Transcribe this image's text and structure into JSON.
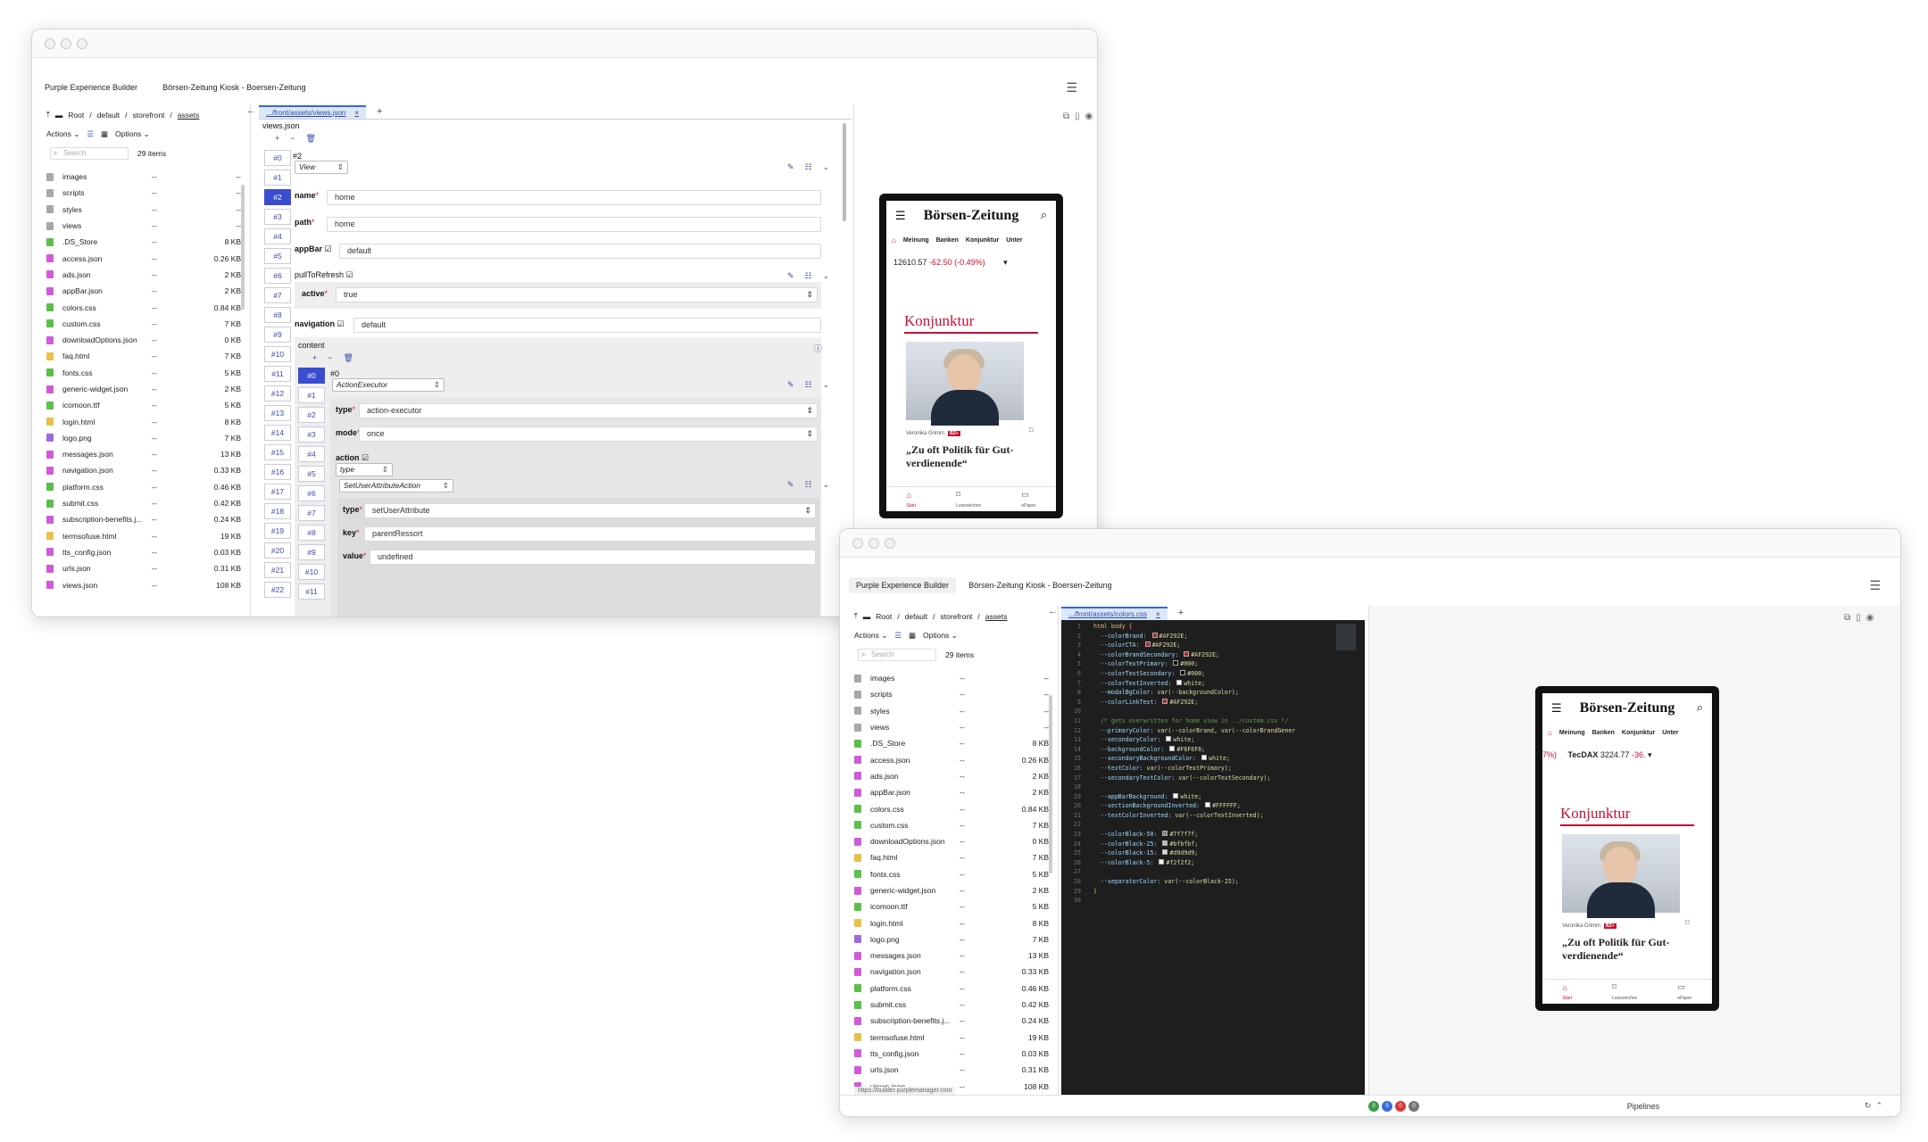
{
  "app": {
    "tab_builder": "Purple Experience Builder",
    "tab_kiosk": "Börsen-Zeitung Kiosk - Boersen-Zeitung",
    "menu_icon": "hamburger-icon"
  },
  "browser": {
    "breadcrumb": [
      "Root",
      "default",
      "storefront",
      "assets"
    ],
    "actions_label": "Actions",
    "options_label": "Options",
    "search_placeholder": "Search",
    "count": "29 items",
    "files": [
      {
        "name": "images",
        "date": "--",
        "size": "--",
        "color": "#a8a8a8"
      },
      {
        "name": "scripts",
        "date": "--",
        "size": "--",
        "color": "#a8a8a8"
      },
      {
        "name": "styles",
        "date": "--",
        "size": "--",
        "color": "#a8a8a8"
      },
      {
        "name": "views",
        "date": "--",
        "size": "--",
        "color": "#a8a8a8"
      },
      {
        "name": ".DS_Store",
        "date": "--",
        "size": "8 KB",
        "color": "#5bbf4a"
      },
      {
        "name": "access.json",
        "date": "--",
        "size": "0.26 KB",
        "color": "#d15ad9"
      },
      {
        "name": "ads.json",
        "date": "--",
        "size": "2 KB",
        "color": "#d15ad9"
      },
      {
        "name": "appBar.json",
        "date": "--",
        "size": "2 KB",
        "color": "#d15ad9"
      },
      {
        "name": "colors.css",
        "date": "--",
        "size": "0.84 KB",
        "color": "#5bbf4a"
      },
      {
        "name": "custom.css",
        "date": "--",
        "size": "7 KB",
        "color": "#5bbf4a"
      },
      {
        "name": "downloadOptions.json",
        "date": "--",
        "size": "0 KB",
        "color": "#d15ad9"
      },
      {
        "name": "faq.html",
        "date": "--",
        "size": "7 KB",
        "color": "#e8c14a"
      },
      {
        "name": "fonts.css",
        "date": "--",
        "size": "5 KB",
        "color": "#5bbf4a"
      },
      {
        "name": "generic-widget.json",
        "date": "--",
        "size": "2 KB",
        "color": "#d15ad9"
      },
      {
        "name": "icomoon.ttf",
        "date": "--",
        "size": "5 KB",
        "color": "#5bbf4a"
      },
      {
        "name": "login.html",
        "date": "--",
        "size": "8 KB",
        "color": "#e8c14a"
      },
      {
        "name": "logo.png",
        "date": "--",
        "size": "7 KB",
        "color": "#a06ae0"
      },
      {
        "name": "messages.json",
        "date": "--",
        "size": "13 KB",
        "color": "#d15ad9"
      },
      {
        "name": "navigation.json",
        "date": "--",
        "size": "0.33 KB",
        "color": "#d15ad9"
      },
      {
        "name": "platform.css",
        "date": "--",
        "size": "0.46 KB",
        "color": "#5bbf4a"
      },
      {
        "name": "submit.css",
        "date": "--",
        "size": "0.42 KB",
        "color": "#5bbf4a"
      },
      {
        "name": "subscription-benefits.j...",
        "date": "--",
        "size": "0.24 KB",
        "color": "#d15ad9"
      },
      {
        "name": "termsofuse.html",
        "date": "--",
        "size": "19 KB",
        "color": "#e8c14a"
      },
      {
        "name": "tts_config.json",
        "date": "--",
        "size": "0.03 KB",
        "color": "#d15ad9"
      },
      {
        "name": "urls.json",
        "date": "--",
        "size": "0.31 KB",
        "color": "#d15ad9"
      },
      {
        "name": "views.json",
        "date": "--",
        "size": "108 KB",
        "color": "#d15ad9"
      }
    ],
    "status_url": "https://builder.purplemanager.com"
  },
  "editorA": {
    "tab": ".../front/assets/views.json",
    "file_title": "views.json",
    "index_outer": [
      "#0",
      "#1",
      "#2",
      "#3",
      "#4",
      "#5",
      "#6",
      "#7",
      "#8",
      "#9",
      "#10",
      "#11",
      "#12",
      "#13",
      "#14",
      "#15",
      "#16",
      "#17",
      "#18",
      "#19",
      "#20",
      "#21",
      "#22"
    ],
    "index_inner": [
      "#0",
      "#1",
      "#2",
      "#3",
      "#4",
      "#5",
      "#6",
      "#7",
      "#8",
      "#9",
      "#10",
      "#11"
    ],
    "item_label": "#2",
    "item_type": "View",
    "name_label": "name",
    "name_value": "home",
    "path_label": "path",
    "path_value": "home",
    "appbar_label": "appBar",
    "appbar_value": "default",
    "pull_label": "pullToRefresh",
    "active_label": "active",
    "active_value": "true",
    "nav_label": "navigation",
    "nav_value": "default",
    "content_label": "content",
    "content_item": "#0",
    "content_type": "ActionExecutor",
    "type_label": "type",
    "type_value": "action-executor",
    "mode_label": "mode",
    "mode_value": "once",
    "action_label": "action",
    "action_type_select": "type",
    "action_class": "SetUserAttributeAction",
    "atype_label": "type",
    "atype_value": "setUserAttribute",
    "key_label": "key",
    "key_value": "parentRessort",
    "value_label": "value",
    "value_value": "undefined"
  },
  "editorB": {
    "tab": ".../front/assets/colors.css",
    "lines": [
      {
        "n": "1",
        "t": "html body {",
        "k": "sel"
      },
      {
        "n": "2",
        "t": "  --colorBrand: ",
        "v": "#AF292E;",
        "sw": "#AF292E"
      },
      {
        "n": "3",
        "t": "  --colorCTA: ",
        "v": "#AF292E;",
        "sw": "#AF292E"
      },
      {
        "n": "4",
        "t": "  --colorBrandSecondary: ",
        "v": "#AF292E;",
        "sw": "#AF292E"
      },
      {
        "n": "5",
        "t": "  --colorTextPrimary: ",
        "v": "#000;",
        "sw": "#000000"
      },
      {
        "n": "6",
        "t": "  --colorTextSecondary: ",
        "v": "#000;",
        "sw": "#000000"
      },
      {
        "n": "7",
        "t": "  --colorTextInverted: ",
        "v": "white;",
        "sw": "#ffffff"
      },
      {
        "n": "8",
        "t": "  --modalBgColor: ",
        "v": "var(--backgroundColor);"
      },
      {
        "n": "9",
        "t": "  --colorLinkText: ",
        "v": "#AF292E;",
        "sw": "#AF292E"
      },
      {
        "n": "10",
        "t": ""
      },
      {
        "n": "11",
        "t": "  /* gets overwritten for home view in ../custom.css */",
        "k": "cm"
      },
      {
        "n": "12",
        "t": "  --primaryColor: ",
        "v": "var(--colorBrand, var(--colorBrandGener"
      },
      {
        "n": "13",
        "t": "  --secondaryColor: ",
        "v": "white;",
        "sw": "#ffffff"
      },
      {
        "n": "14",
        "t": "  --backgroundColor: ",
        "v": "#F6F6F6;",
        "sw": "#F6F6F6"
      },
      {
        "n": "15",
        "t": "  --secondaryBackgroundColor: ",
        "v": "white;",
        "sw": "#ffffff"
      },
      {
        "n": "16",
        "t": "  --textColor: ",
        "v": "var(--colorTextPrimary);"
      },
      {
        "n": "17",
        "t": "  --secondaryTextColor: ",
        "v": "var(--colorTextSecondary);"
      },
      {
        "n": "18",
        "t": ""
      },
      {
        "n": "19",
        "t": "  --appBarBackground: ",
        "v": "white;",
        "sw": "#ffffff"
      },
      {
        "n": "20",
        "t": "  --sectionBackgroundInverted: ",
        "v": "#FFFFFF;",
        "sw": "#FFFFFF"
      },
      {
        "n": "21",
        "t": "  --textColorInverted: ",
        "v": "var(--colorTextInverted);"
      },
      {
        "n": "22",
        "t": ""
      },
      {
        "n": "23",
        "t": "  --colorBlack-50: ",
        "v": "#7f7f7f;",
        "sw": "#7f7f7f"
      },
      {
        "n": "24",
        "t": "  --colorBlack-25: ",
        "v": "#bfbfbf;",
        "sw": "#bfbfbf"
      },
      {
        "n": "25",
        "t": "  --colorBlack-15: ",
        "v": "#d9d9d9;",
        "sw": "#d9d9d9"
      },
      {
        "n": "26",
        "t": "  --colorBlack-5: ",
        "v": "#f2f2f2;",
        "sw": "#f2f2f2"
      },
      {
        "n": "27",
        "t": ""
      },
      {
        "n": "28",
        "t": "  --separatorColor: ",
        "v": "var(--colorBlack-25);"
      },
      {
        "n": "29",
        "t": "}",
        "k": "sel"
      },
      {
        "n": "30",
        "t": ""
      }
    ]
  },
  "preview": {
    "brand": "Börsen-Zeitung",
    "nav": [
      "Meinung",
      "Banken",
      "Konjunktur",
      "Unter"
    ],
    "tickerA_value": "12610.57",
    "tickerA_change": "-62.50 (-0.49%)",
    "tickerB_prefix": "7%)",
    "tickerB_name": "TecDAX",
    "tickerB_value": "3224.77",
    "tickerB_change": "-36.",
    "section": "Konjunktur",
    "author": "Veronika Grimm",
    "author_tag": "BZ+",
    "headline": "„Zu oft Politik für Gut-verdienende“",
    "bottom_nav": [
      "Start",
      "Lesezeichen",
      "ePaper"
    ]
  },
  "status": {
    "pills": [
      "0",
      "0",
      "0",
      "0"
    ],
    "pill_colors": [
      "#3a9b4a",
      "#3a6ad8",
      "#d83a3a",
      "#777777"
    ],
    "pipelines": "Pipelines"
  }
}
